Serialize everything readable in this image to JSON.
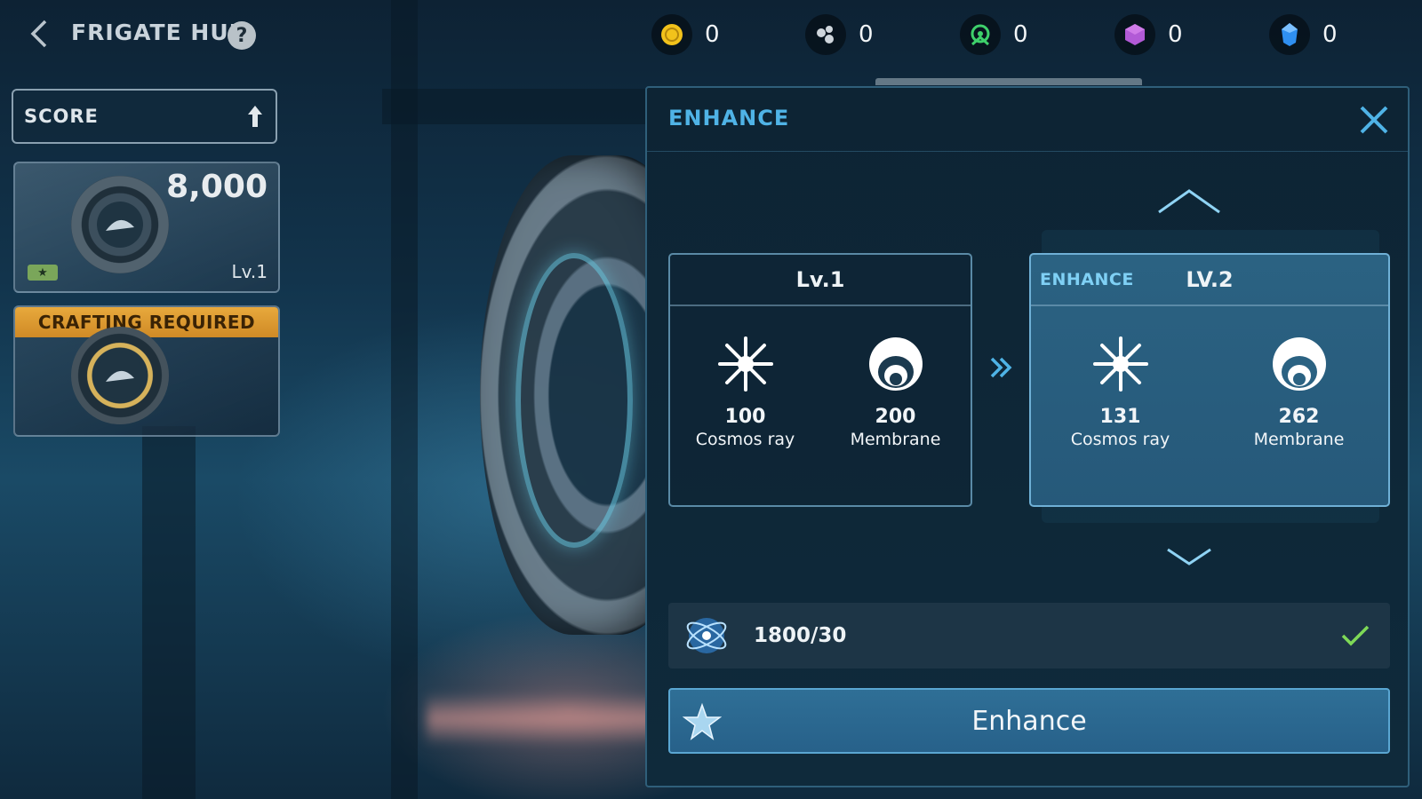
{
  "topbar": {
    "title": "FRIGATE HUB",
    "help": "?",
    "currencies": [
      {
        "icon": "gold-coin-icon",
        "value": "0",
        "color": "#f2c21b"
      },
      {
        "icon": "alloy-cluster-icon",
        "value": "0",
        "color": "#cfd6dc"
      },
      {
        "icon": "green-core-icon",
        "value": "0",
        "color": "#3ed06b"
      },
      {
        "icon": "purple-cube-icon",
        "value": "0",
        "color": "#b25ad6"
      },
      {
        "icon": "blue-crystal-icon",
        "value": "0",
        "color": "#2f8ff0"
      }
    ]
  },
  "sidebar": {
    "sort_label": "SCORE",
    "cards": [
      {
        "score": "8,000",
        "level": "Lv.1"
      },
      {
        "banner": "CRAFTING REQUIRED"
      }
    ]
  },
  "panel": {
    "title": "ENHANCE",
    "current": {
      "level": "Lv.1",
      "materials": [
        {
          "icon": "cosmos-ray-icon",
          "amount": "100",
          "name": "Cosmos ray"
        },
        {
          "icon": "membrane-icon",
          "amount": "200",
          "name": "Membrane"
        }
      ]
    },
    "next": {
      "tag": "ENHANCE",
      "level": "LV.2",
      "materials": [
        {
          "icon": "cosmos-ray-icon",
          "amount": "131",
          "name": "Cosmos ray"
        },
        {
          "icon": "membrane-icon",
          "amount": "262",
          "name": "Membrane"
        }
      ]
    },
    "requirement": {
      "value": "1800/30",
      "met": true
    },
    "button_label": "Enhance"
  },
  "colors": {
    "accent": "#4fb3e6",
    "panel_bg": "#0f2a3b",
    "check": "#7ed957"
  }
}
